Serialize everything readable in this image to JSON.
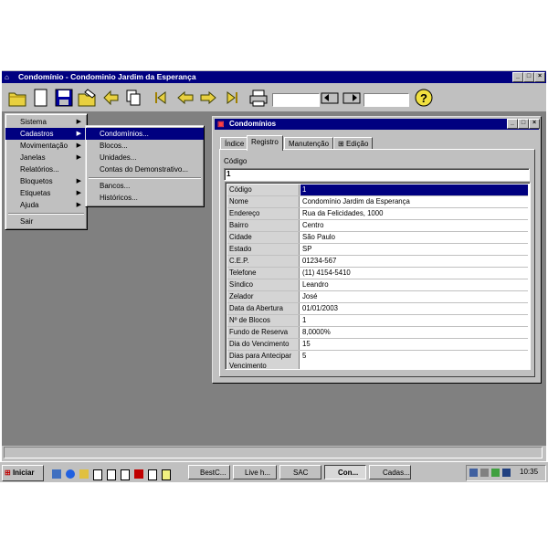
{
  "window": {
    "title": "Condomínio - Condominio Jardim da Esperança",
    "controls": [
      "_",
      "□",
      "×"
    ]
  },
  "toolbar": {
    "field1_value": "",
    "field2_value": ""
  },
  "main_menu": {
    "items": [
      {
        "label": "Sistema",
        "arrow": "▶"
      },
      {
        "label": "Cadastros",
        "arrow": "▶"
      },
      {
        "label": "Movimentação",
        "arrow": "▶"
      },
      {
        "label": "Janelas",
        "arrow": "▶"
      },
      {
        "label": "Relatórios...",
        "arrow": ""
      },
      {
        "label": "Bloquetos",
        "arrow": "▶"
      },
      {
        "label": "Etiquetas",
        "arrow": "▶"
      },
      {
        "label": "Ajuda",
        "arrow": "▶"
      },
      {
        "label": "Sair",
        "arrow": ""
      }
    ],
    "selected": "Cadastros"
  },
  "submenu": {
    "items": [
      "Condomínios...",
      "Blocos...",
      "Unidades...",
      "Contas do Demonstrativo...",
      "Bancos...",
      "Históricos..."
    ],
    "selected": "Condomínios..."
  },
  "child_window": {
    "title": "Condomínios",
    "tabs": [
      "Índice",
      "Registro",
      "Manutenção",
      "Edição"
    ],
    "active_tab": "Registro",
    "code_label": "Código",
    "code_value": "1",
    "fields": [
      {
        "label": "Código",
        "value": "1"
      },
      {
        "label": "Nome",
        "value": "Condomínio Jardim da Esperança"
      },
      {
        "label": "Endereço",
        "value": "Rua da Felicidades, 1000"
      },
      {
        "label": "Bairro",
        "value": "Centro"
      },
      {
        "label": "Cidade",
        "value": "São Paulo"
      },
      {
        "label": "Estado",
        "value": "SP"
      },
      {
        "label": "C.E.P.",
        "value": "01234-567"
      },
      {
        "label": "Telefone",
        "value": "(11) 4154-5410"
      },
      {
        "label": "Síndico",
        "value": "Leandro"
      },
      {
        "label": "Zelador",
        "value": "José"
      },
      {
        "label": "Data da Abertura",
        "value": "01/01/2003"
      },
      {
        "label": "Nº de Blocos",
        "value": "1"
      },
      {
        "label": "Fundo de Reserva",
        "value": "8,0000%"
      },
      {
        "label": "Dia do Vencimento",
        "value": "15"
      },
      {
        "label": "Dias para Antecipar Vencimento",
        "value": "5"
      }
    ]
  },
  "taskbar": {
    "start_label": "Iniciar",
    "buttons": [
      "BestC...",
      "Live h...",
      "SAC",
      "Con...",
      "Cadas..."
    ],
    "active_button": "Con...",
    "clock": "10:35"
  },
  "colors": {
    "title_active": "#000080",
    "face": "#c0c0c0",
    "workspace": "#808080"
  }
}
